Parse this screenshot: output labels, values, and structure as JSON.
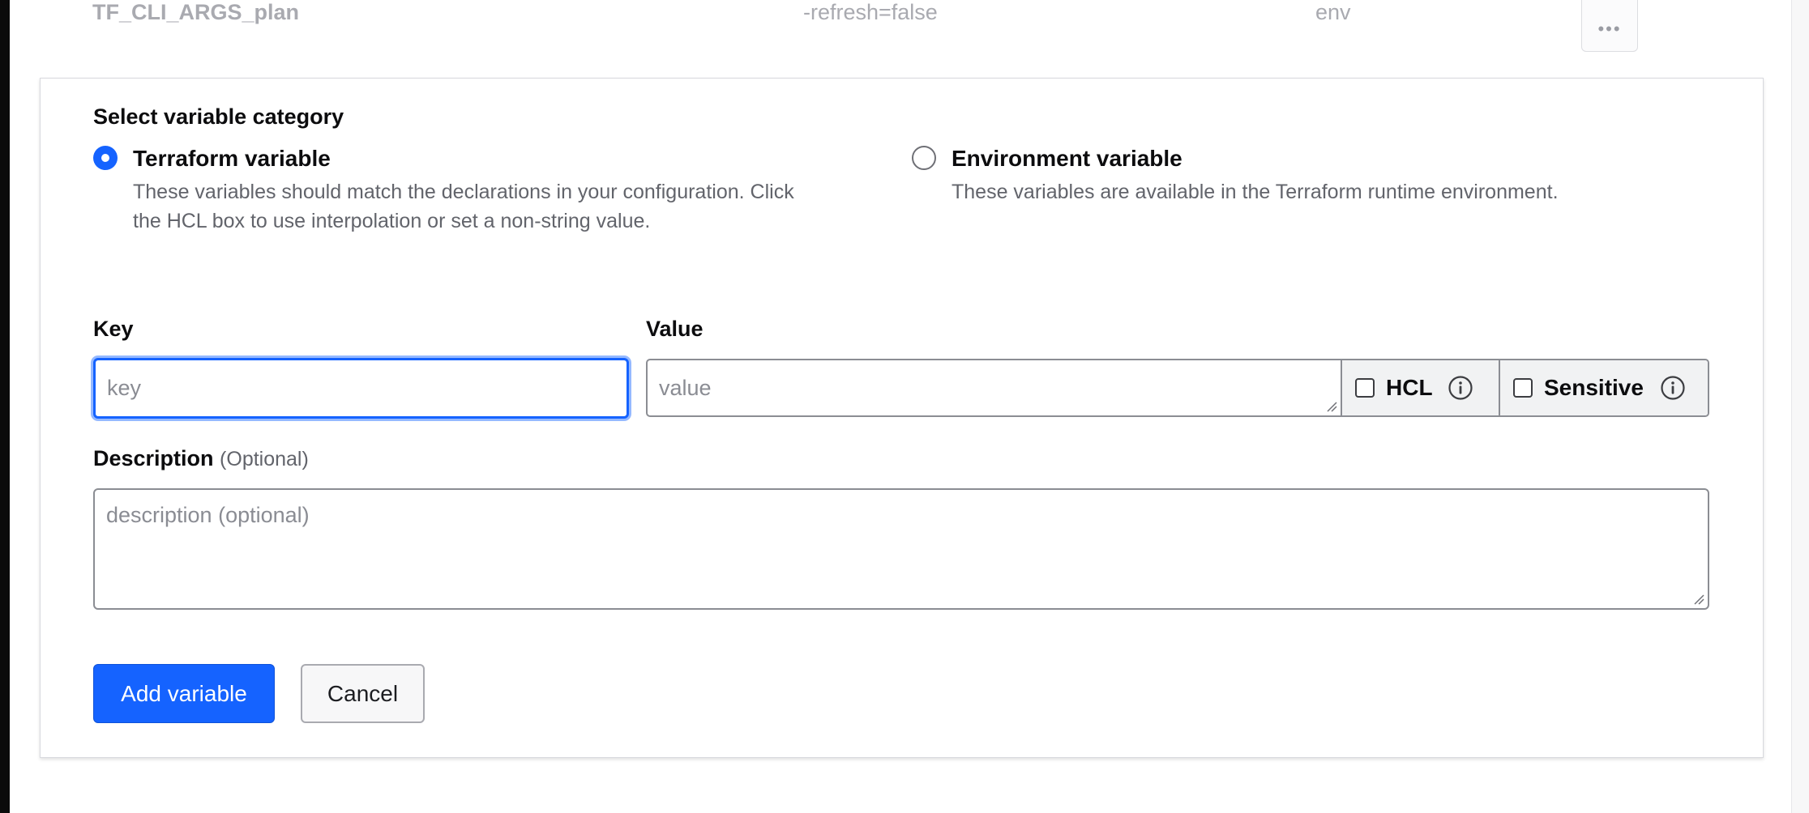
{
  "previous_row": {
    "key": "TF_CLI_ARGS_plan",
    "value": "-refresh=false",
    "category": "env",
    "menu_label": "•••"
  },
  "form": {
    "category_heading": "Select variable category",
    "options": [
      {
        "title": "Terraform variable",
        "description_line1": "These variables should match the declarations in your configuration. Click",
        "description_line2": "the HCL box to use interpolation or set a non-string value.",
        "selected": true
      },
      {
        "title": "Environment variable",
        "description_line1": "These variables are available in the Terraform runtime environment.",
        "selected": false
      }
    ],
    "key_label": "Key",
    "key_placeholder": "key",
    "value_label": "Value",
    "value_placeholder": "value",
    "hcl_label": "HCL",
    "sensitive_label": "Sensitive",
    "description_label": "Description",
    "description_optional": "(Optional)",
    "description_placeholder": "description (optional)",
    "add_button": "Add variable",
    "cancel_button": "Cancel"
  },
  "colors": {
    "accent": "#1563ff",
    "muted_text": "#62646b",
    "border": "#8b8d93"
  },
  "icons": [
    "ellipsis-icon",
    "info-icon",
    "resize-grip-icon"
  ]
}
